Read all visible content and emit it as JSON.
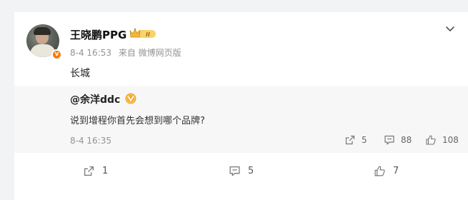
{
  "post": {
    "username": "王晓鹏PPG",
    "badge_text": "II",
    "verified_icon": "orange-v-icon",
    "time": "8-4 16:53",
    "source": "来自 微博网页版",
    "content": "长城"
  },
  "quoted": {
    "user": "@余洋ddc",
    "text": "说到增程你首先会想到哪个品牌?",
    "time": "8-4 16:35",
    "actions": {
      "repost": "5",
      "comment": "88",
      "like": "108"
    }
  },
  "footer": {
    "repost": "1",
    "comment": "5",
    "like": "7"
  },
  "colors": {
    "background": "#f2f3f5",
    "accent_orange": "#f27c14",
    "gold": "#f3b63a",
    "meta_gray": "#939393"
  }
}
